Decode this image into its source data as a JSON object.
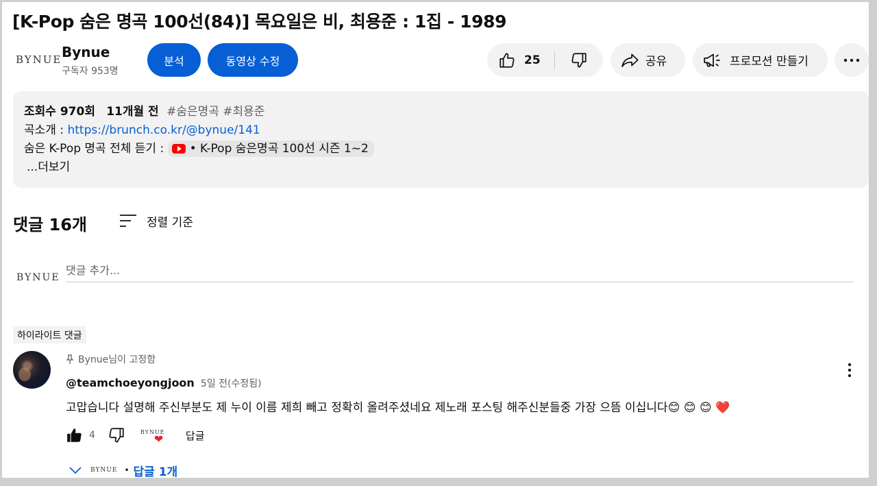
{
  "video": {
    "title": "[K-Pop 숨은 명곡 100선(84)] 목요일은 비, 최용준 : 1집 - 1989"
  },
  "channel": {
    "logo_text": "BYNUE",
    "name": "Bynue",
    "subscribers": "구독자 953명"
  },
  "actions": {
    "analytics_label": "분석",
    "edit_label": "동영상 수정",
    "like_count": "25",
    "share_label": "공유",
    "promote_label": "프로모션 만들기"
  },
  "description": {
    "views": "조회수 970회",
    "age": "11개월 전",
    "hashtags": "#숨은명곡 #최용준",
    "line1_prefix": "곡소개 : ",
    "line1_link": "https://brunch.co.kr/@bynue/141",
    "line2_prefix": "숨은 K-Pop 명곡 전체 듣기 : ",
    "line2_playlist": "• K-Pop 숨은명곡 100선 시즌 1~2",
    "more_label": "...더보기"
  },
  "comments": {
    "count_label": "댓글 16개",
    "sort_label": "정렬 기준",
    "add_placeholder": "댓글 추가...",
    "highlight_label": "하이라이트 댓글",
    "items": [
      {
        "pinned_by": "Bynue님이 고정함",
        "author": "@teamchoeyongjoon",
        "time": "5일 전(수정됨)",
        "text": "고맙습니다 설명해 주신부분도 제 누이 이름 제희 빼고 정확히 올려주셨네요 제노래 포스팅 해주신분들중 가장 으뜸 이십니다😊 😊 😊 ❤️",
        "likes": "4",
        "creator_heart_logo": "BYNUE",
        "reply_label": "답글",
        "replies_logo": "BYNUE",
        "replies_label": "답글 1개"
      }
    ]
  }
}
